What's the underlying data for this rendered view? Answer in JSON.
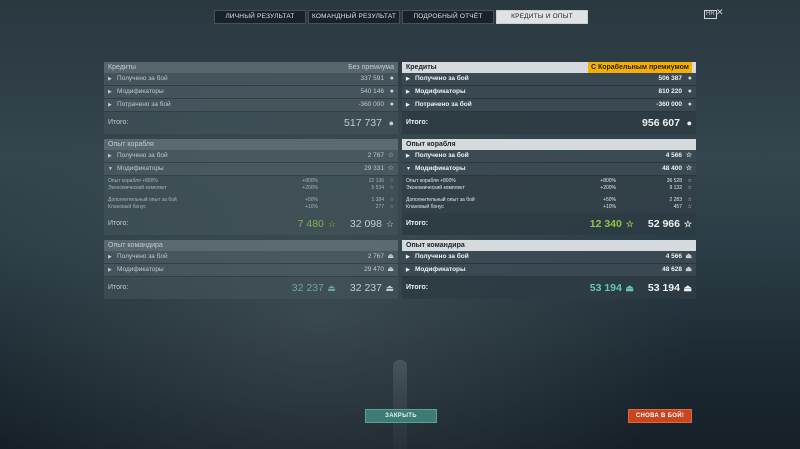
{
  "tabs": [
    "ЛИЧНЫЙ РЕЗУЛЬТАТ",
    "КОМАНДНЫЙ РЕЗУЛЬТАТ",
    "ПОДРОБНЫЙ ОТЧЁТ",
    "КРЕДИТЫ И ОПЫТ"
  ],
  "hr_label": "HR",
  "close_glyph": "✕",
  "left": {
    "credits": {
      "title": "Кредиты",
      "subtitle": "Без премиума",
      "rows": [
        {
          "label": "Получено за бой",
          "value": "337 591"
        },
        {
          "label": "Модификаторы",
          "value": "540 146"
        },
        {
          "label": "Потрачено за бой",
          "value": "-360 000"
        }
      ],
      "total_label": "Итого:",
      "total": "517 737"
    },
    "ship_xp": {
      "title": "Опыт корабля",
      "rows": [
        {
          "label": "Получено за бой",
          "value": "2 767"
        },
        {
          "label": "Модификаторы",
          "value": "29 331"
        }
      ],
      "details": [
        {
          "label": "Опыт корабля +800%",
          "pct": "+800%",
          "value": "22 136"
        },
        {
          "label": "Экономический комплект",
          "pct": "+200%",
          "value": "5 534"
        },
        {
          "label": "Дополнительный опыт за бой",
          "pct": "+50%",
          "value": "1 384"
        },
        {
          "label": "Клановый бонус",
          "pct": "+10%",
          "value": "277"
        }
      ],
      "total_label": "Итого:",
      "free_total": "7 480",
      "total": "32 098"
    },
    "commander_xp": {
      "title": "Опыт командира",
      "rows": [
        {
          "label": "Получено за бой",
          "value": "2 767"
        },
        {
          "label": "Модификаторы",
          "value": "29 470"
        }
      ],
      "total_label": "Итого:",
      "elite_total": "32 237",
      "total": "32 237"
    }
  },
  "right": {
    "credits": {
      "title": "Кредиты",
      "subtitle": "С Корабельным премиумом",
      "rows": [
        {
          "label": "Получено за бой",
          "value": "506 387"
        },
        {
          "label": "Модификаторы",
          "value": "810 220"
        },
        {
          "label": "Потрачено за бой",
          "value": "-360 000"
        }
      ],
      "total_label": "Итого:",
      "total": "956 607"
    },
    "ship_xp": {
      "title": "Опыт корабля",
      "rows": [
        {
          "label": "Получено за бой",
          "value": "4 566"
        },
        {
          "label": "Модификаторы",
          "value": "48 400"
        }
      ],
      "details": [
        {
          "label": "Опыт корабля +800%",
          "pct": "+800%",
          "value": "36 528"
        },
        {
          "label": "Экономический комплект",
          "pct": "+200%",
          "value": "9 132"
        },
        {
          "label": "Дополнительный опыт за бой",
          "pct": "+50%",
          "value": "2 283"
        },
        {
          "label": "Клановый бонус",
          "pct": "+10%",
          "value": "457"
        }
      ],
      "total_label": "Итого:",
      "free_total": "12 340",
      "total": "52 966"
    },
    "commander_xp": {
      "title": "Опыт командира",
      "rows": [
        {
          "label": "Получено за бой",
          "value": "4 566"
        },
        {
          "label": "Модификаторы",
          "value": "48 628"
        }
      ],
      "total_label": "Итого:",
      "elite_total": "53 194",
      "total": "53 194"
    }
  },
  "buttons": {
    "close": "ЗАКРЫТЬ",
    "battle": "СНОВА В БОЙ!"
  }
}
